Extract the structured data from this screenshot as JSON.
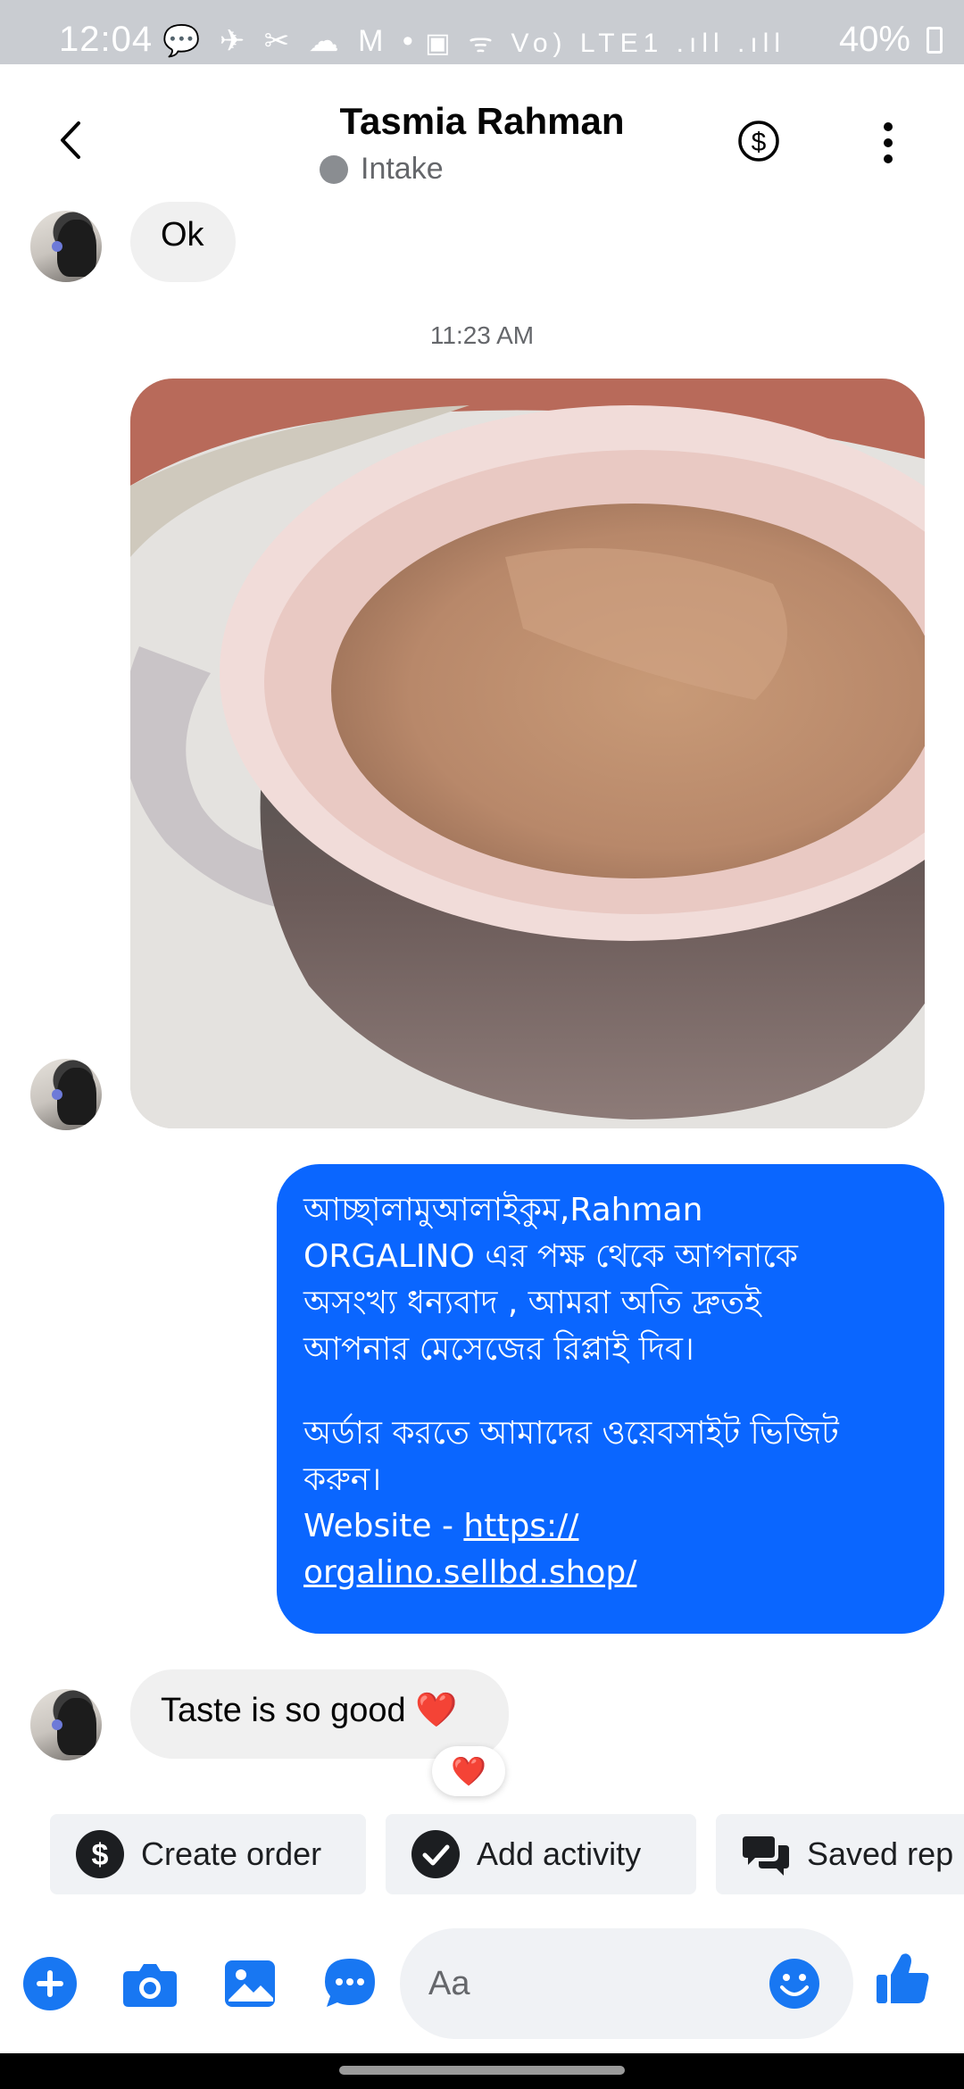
{
  "status_bar": {
    "time": "12:04",
    "left_icons": "💬 ✈ ✂ ☁ M •",
    "right_icons": "▣ ᯤ Vo) LTE1 .ıll .ıll",
    "battery": "40%"
  },
  "header": {
    "contact_name": "Tasmia Rahman",
    "label": "Intake"
  },
  "messages": {
    "first_incoming": "Ok",
    "timestamp": "11:23 AM",
    "outgoing": {
      "line1": "আচ্ছালামুআলাইকুম,Rahman",
      "line2": "ORGALINO এর পক্ষ থেকে আপনাকে",
      "line3": "অসংখ্য ধন্যবাদ , আমরা অতি দ্রুতই",
      "line4": "আপনার মেসেজের রিপ্লাই দিব।",
      "line5": "অর্ডার করতে আমাদের ওয়েবসাইট ভিজিট",
      "line6": "করুন।",
      "website_label": "Website - ",
      "link_part1": "https://",
      "link_part2": "orgalino.sellbd.shop/"
    },
    "last_incoming": "Taste is so good ❤️",
    "reaction": "❤️"
  },
  "quick_actions": [
    {
      "label": "Create order",
      "icon": "dollar-circle-icon"
    },
    {
      "label": "Add activity",
      "icon": "check-circle-icon"
    },
    {
      "label": "Saved rep",
      "icon": "saved-replies-icon"
    }
  ],
  "composer": {
    "placeholder": "Aa"
  },
  "colors": {
    "brand_blue": "#0a66ff",
    "icon_blue": "#1877f2",
    "incoming_bubble": "#f0f0f0"
  }
}
